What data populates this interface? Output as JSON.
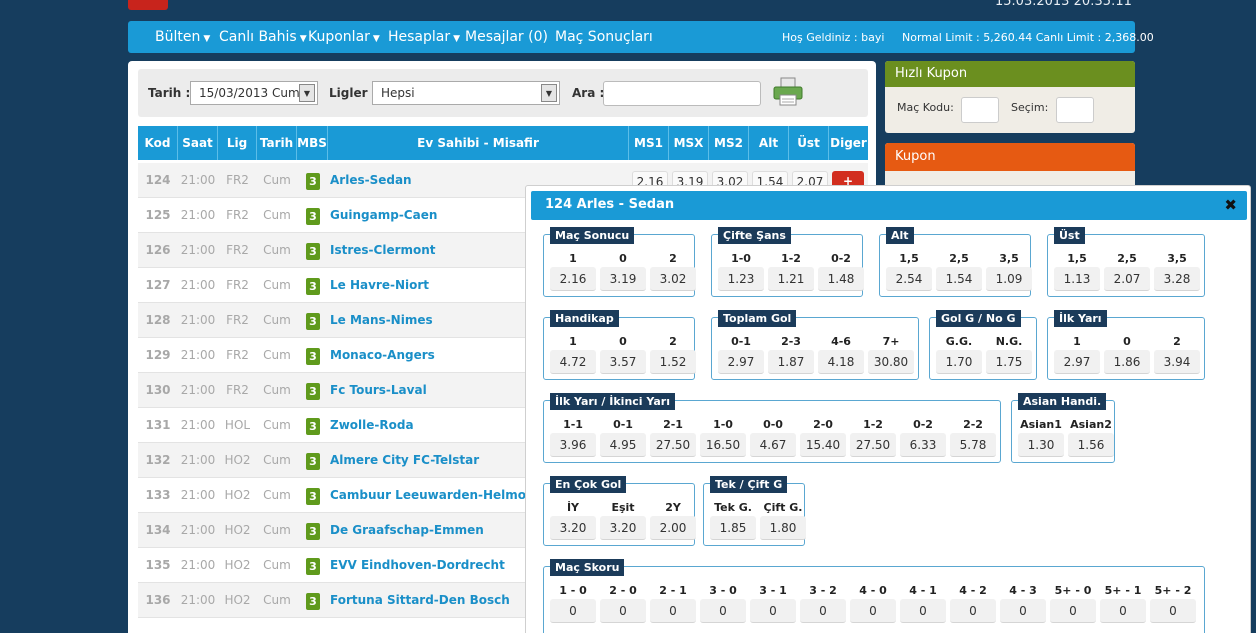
{
  "header": {
    "datetime": "15.03.2013 20:35:11"
  },
  "nav": {
    "items": [
      "Bülten",
      "Canlı Bahis",
      "Kuponlar",
      "Hesaplar",
      "Mesajlar (0)",
      "Maç Sonuçları"
    ],
    "welcome": "Hoş Geldiniz : bayi",
    "limits": "Normal Limit : 5,260.44 Canlı Limit : 2,368.00"
  },
  "filter": {
    "date_label": "Tarih :",
    "date_value": "15/03/2013 Cum",
    "league_label": "Ligler :",
    "league_value": "Hepsi",
    "search_label": "Ara :"
  },
  "table": {
    "headers": [
      "Kod",
      "Saat",
      "Lig",
      "Tarih",
      "MBS",
      "Ev Sahibi - Misafir",
      "MS1",
      "MSX",
      "MS2",
      "Alt",
      "Üst",
      "Diger"
    ],
    "first_row_odds": [
      "2.16",
      "3.19",
      "3.02",
      "1.54",
      "2.07"
    ],
    "plus": "+",
    "rows": [
      {
        "kod": "124",
        "saat": "21:00",
        "lig": "FR2",
        "tarih": "Cum",
        "mbs": "3",
        "teams": "Arles-Sedan"
      },
      {
        "kod": "125",
        "saat": "21:00",
        "lig": "FR2",
        "tarih": "Cum",
        "mbs": "3",
        "teams": "Guingamp-Caen"
      },
      {
        "kod": "126",
        "saat": "21:00",
        "lig": "FR2",
        "tarih": "Cum",
        "mbs": "3",
        "teams": "Istres-Clermont"
      },
      {
        "kod": "127",
        "saat": "21:00",
        "lig": "FR2",
        "tarih": "Cum",
        "mbs": "3",
        "teams": "Le Havre-Niort"
      },
      {
        "kod": "128",
        "saat": "21:00",
        "lig": "FR2",
        "tarih": "Cum",
        "mbs": "3",
        "teams": "Le Mans-Nimes"
      },
      {
        "kod": "129",
        "saat": "21:00",
        "lig": "FR2",
        "tarih": "Cum",
        "mbs": "3",
        "teams": "Monaco-Angers"
      },
      {
        "kod": "130",
        "saat": "21:00",
        "lig": "FR2",
        "tarih": "Cum",
        "mbs": "3",
        "teams": "Fc Tours-Laval"
      },
      {
        "kod": "131",
        "saat": "21:00",
        "lig": "HOL",
        "tarih": "Cum",
        "mbs": "3",
        "teams": "Zwolle-Roda"
      },
      {
        "kod": "132",
        "saat": "21:00",
        "lig": "HO2",
        "tarih": "Cum",
        "mbs": "3",
        "teams": "Almere City FC-Telstar"
      },
      {
        "kod": "133",
        "saat": "21:00",
        "lig": "HO2",
        "tarih": "Cum",
        "mbs": "3",
        "teams": "Cambuur Leeuwarden-Helmond Sp"
      },
      {
        "kod": "134",
        "saat": "21:00",
        "lig": "HO2",
        "tarih": "Cum",
        "mbs": "3",
        "teams": "De Graafschap-Emmen"
      },
      {
        "kod": "135",
        "saat": "21:00",
        "lig": "HO2",
        "tarih": "Cum",
        "mbs": "3",
        "teams": "EVV Eindhoven-Dordrecht"
      },
      {
        "kod": "136",
        "saat": "21:00",
        "lig": "HO2",
        "tarih": "Cum",
        "mbs": "3",
        "teams": "Fortuna Sittard-Den Bosch"
      }
    ]
  },
  "hizli_kupon": {
    "title": "Hızlı Kupon",
    "mac_kodu": "Maç Kodu:",
    "secim": "Seçim:"
  },
  "kupon": {
    "title": "Kupon"
  },
  "modal": {
    "title": "124 Arles - Sedan",
    "close": "✖",
    "groups": [
      {
        "title": "Maç Sonucu",
        "labels": [
          "1",
          "0",
          "2"
        ],
        "values": [
          "2.16",
          "3.19",
          "3.02"
        ]
      },
      {
        "title": "Çifte Şans",
        "labels": [
          "1-0",
          "1-2",
          "0-2"
        ],
        "values": [
          "1.23",
          "1.21",
          "1.48"
        ]
      },
      {
        "title": "Alt",
        "labels": [
          "1,5",
          "2,5",
          "3,5"
        ],
        "values": [
          "2.54",
          "1.54",
          "1.09"
        ]
      },
      {
        "title": "Üst",
        "labels": [
          "1,5",
          "2,5",
          "3,5"
        ],
        "values": [
          "1.13",
          "2.07",
          "3.28"
        ]
      },
      {
        "title": "Handikap",
        "labels": [
          "1",
          "0",
          "2"
        ],
        "values": [
          "4.72",
          "3.57",
          "1.52"
        ]
      },
      {
        "title": "Toplam Gol",
        "labels": [
          "0-1",
          "2-3",
          "4-6",
          "7+"
        ],
        "values": [
          "2.97",
          "1.87",
          "4.18",
          "30.80"
        ]
      },
      {
        "title": "Gol G / No G",
        "labels": [
          "G.G.",
          "N.G."
        ],
        "values": [
          "1.70",
          "1.75"
        ]
      },
      {
        "title": "İlk Yarı",
        "labels": [
          "1",
          "0",
          "2"
        ],
        "values": [
          "2.97",
          "1.86",
          "3.94"
        ]
      },
      {
        "title": "İlk Yarı / İkinci Yarı",
        "labels": [
          "1-1",
          "0-1",
          "2-1",
          "1-0",
          "0-0",
          "2-0",
          "1-2",
          "0-2",
          "2-2"
        ],
        "values": [
          "3.96",
          "4.95",
          "27.50",
          "16.50",
          "4.67",
          "15.40",
          "27.50",
          "6.33",
          "5.78"
        ]
      },
      {
        "title": "Asian Handi.",
        "labels": [
          "Asian1",
          "Asian2"
        ],
        "values": [
          "1.30",
          "1.56"
        ]
      },
      {
        "title": "En Çok Gol",
        "labels": [
          "İY",
          "Eşit",
          "2Y"
        ],
        "values": [
          "3.20",
          "3.20",
          "2.00"
        ]
      },
      {
        "title": "Tek / Çift G",
        "labels": [
          "Tek G.",
          "Çift G."
        ],
        "values": [
          "1.85",
          "1.80"
        ]
      },
      {
        "title": "Maç Skoru",
        "labels": [
          "1 - 0",
          "2 - 0",
          "2 - 1",
          "3 - 0",
          "3 - 1",
          "3 - 2",
          "4 - 0",
          "4 - 1",
          "4 - 2",
          "4 - 3",
          "5+ - 0",
          "5+ - 1",
          "5+ - 2"
        ],
        "values": [
          "0",
          "0",
          "0",
          "0",
          "0",
          "0",
          "0",
          "0",
          "0",
          "0",
          "0",
          "0",
          "0"
        ]
      }
    ]
  }
}
